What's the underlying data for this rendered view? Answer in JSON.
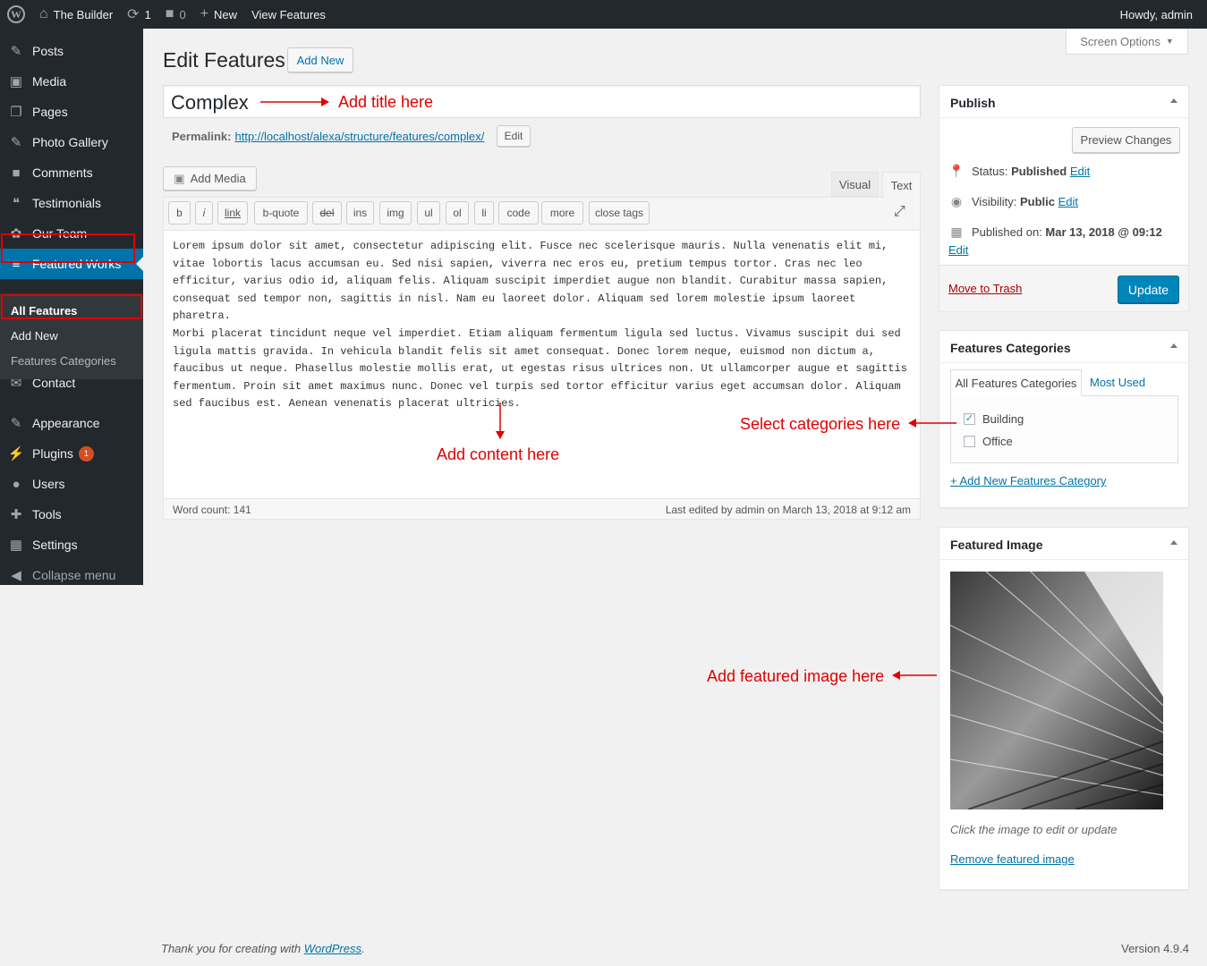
{
  "adminbar": {
    "site_name": "The Builder",
    "updates_count": "1",
    "comments_count": "0",
    "new_label": "New",
    "view_label": "View Features",
    "howdy": "Howdy, admin"
  },
  "sidebar": {
    "items": [
      {
        "label": "Posts",
        "icon": "✎"
      },
      {
        "label": "Media",
        "icon": "▣"
      },
      {
        "label": "Pages",
        "icon": "❐"
      },
      {
        "label": "Photo Gallery",
        "icon": "✎"
      },
      {
        "label": "Comments",
        "icon": "■"
      },
      {
        "label": "Testimonials",
        "icon": "❝"
      },
      {
        "label": "Our Team",
        "icon": "✿"
      },
      {
        "label": "Featured Works",
        "icon": "≡"
      },
      {
        "label": "Contact",
        "icon": "✉"
      },
      {
        "label": "Appearance",
        "icon": "✎"
      },
      {
        "label": "Plugins",
        "icon": "⚡"
      },
      {
        "label": "Users",
        "icon": "●"
      },
      {
        "label": "Tools",
        "icon": "✚"
      },
      {
        "label": "Settings",
        "icon": "▦"
      },
      {
        "label": "Collapse menu",
        "icon": "◀"
      }
    ],
    "plugins_badge": "1",
    "submenu": [
      "All Features",
      "Add New",
      "Features Categories"
    ]
  },
  "screen_options": "Screen Options",
  "page": {
    "title": "Edit Features",
    "add_new": "Add New"
  },
  "editor": {
    "post_title": "Complex",
    "permalink_label": "Permalink:",
    "permalink_url": "http://localhost/alexa/structure/features/complex/",
    "permalink_edit": "Edit",
    "add_media": "Add Media",
    "tab_visual": "Visual",
    "tab_text": "Text",
    "quicktags": [
      "b",
      "i",
      "link",
      "b-quote",
      "del",
      "ins",
      "img",
      "ul",
      "ol",
      "li",
      "code",
      "more",
      "close tags"
    ],
    "content_p1": "Lorem ipsum dolor sit amet, consectetur adipiscing elit. Fusce nec scelerisque mauris. Nulla venenatis elit mi, vitae lobortis lacus accumsan eu. Sed nisi sapien, viverra nec eros eu, pretium tempus tortor. Cras nec leo efficitur, varius odio id, aliquam felis. Aliquam suscipit imperdiet augue non blandit. Curabitur massa sapien, consequat sed tempor non, sagittis in nisl. Nam eu laoreet dolor. Aliquam sed lorem molestie ipsum laoreet pharetra.",
    "content_p2": "Morbi placerat tincidunt neque vel imperdiet. Etiam aliquam fermentum ligula sed luctus. Vivamus suscipit dui sed ligula mattis gravida. In vehicula blandit felis sit amet consequat. Donec lorem neque, euismod non dictum a, faucibus ut neque. Phasellus molestie mollis erat, ut egestas risus ultrices non. Ut ullamcorper augue et sagittis fermentum. Proin sit amet maximus nunc. Donec vel turpis sed tortor efficitur varius eget accumsan dolor. Aliquam sed faucibus est. Aenean venenatis placerat ultricies.",
    "word_count": "Word count: 141",
    "last_edited": "Last edited by admin on March 13, 2018 at 9:12 am"
  },
  "annotations": {
    "title": "Add title here",
    "content": "Add content here",
    "categories": "Select categories here",
    "image": "Add featured image here"
  },
  "publish": {
    "title": "Publish",
    "preview": "Preview Changes",
    "status_label": "Status:",
    "status_value": "Published",
    "visibility_label": "Visibility:",
    "visibility_value": "Public",
    "published_label": "Published on:",
    "published_value": "Mar 13, 2018 @ 09:12",
    "edit": "Edit",
    "trash": "Move to Trash",
    "update": "Update"
  },
  "categories": {
    "title": "Features Categories",
    "tab_all": "All Features Categories",
    "tab_used": "Most Used",
    "items": [
      {
        "label": "Building",
        "checked": true
      },
      {
        "label": "Office",
        "checked": false
      }
    ],
    "add_new": "+ Add New Features Category"
  },
  "featured_image": {
    "title": "Featured Image",
    "hint": "Click the image to edit or update",
    "remove": "Remove featured image"
  },
  "footer": {
    "thanks": "Thank you for creating with",
    "wp_link": "WordPress",
    "version": "Version 4.9.4"
  },
  "colors": {
    "admin_dark": "#23282d",
    "accent": "#0073aa",
    "annotation": "#e00000"
  }
}
